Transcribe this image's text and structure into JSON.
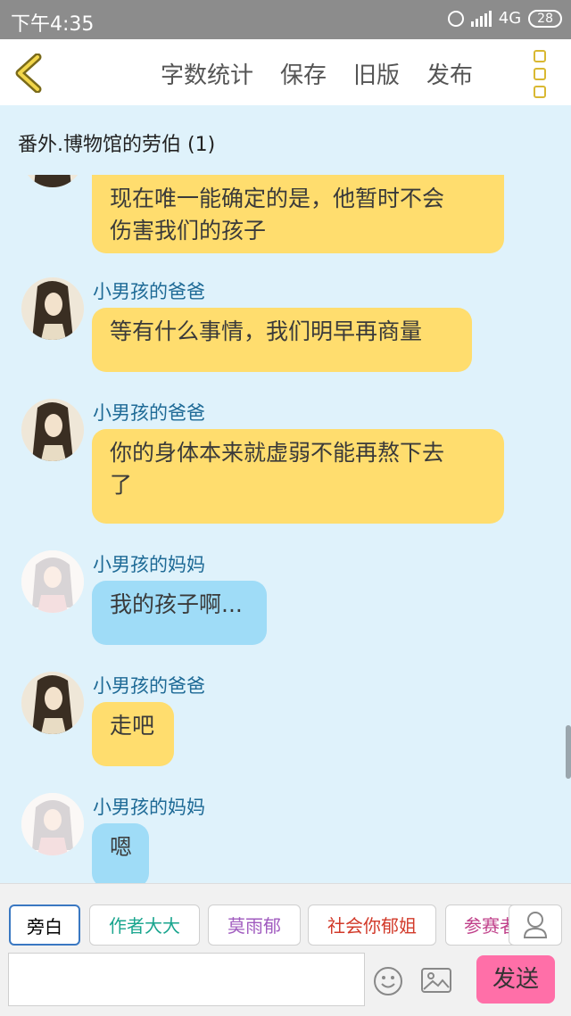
{
  "status_bar": {
    "time": "下午4:35",
    "network": "4G",
    "battery": "28"
  },
  "toolbar": {
    "items": [
      "字数统计",
      "保存",
      "旧版",
      "发布"
    ]
  },
  "chat": {
    "title": "番外.博物馆的劳伯 (1)",
    "messages": [
      {
        "sender": "",
        "role": "dad",
        "lines": [
          "现在唯一能确定的是，他暂时不会",
          "伤害我们的孩子"
        ]
      },
      {
        "sender": "小男孩的爸爸",
        "role": "dad",
        "lines": [
          "等有什么事情，我们明早再商量"
        ]
      },
      {
        "sender": "小男孩的爸爸",
        "role": "dad",
        "lines": [
          "你的身体本来就虚弱不能再熬下去",
          "了"
        ]
      },
      {
        "sender": "小男孩的妈妈",
        "role": "mom",
        "lines": [
          "我的孩子啊..."
        ]
      },
      {
        "sender": "小男孩的爸爸",
        "role": "dad",
        "lines": [
          "走吧"
        ]
      },
      {
        "sender": "小男孩的妈妈",
        "role": "mom",
        "lines": [
          "嗯"
        ]
      }
    ]
  },
  "characters": [
    {
      "label": "旁白",
      "color": "#333333"
    },
    {
      "label": "作者大大",
      "color": "#19a58e"
    },
    {
      "label": "莫雨郁",
      "color": "#a05bbf"
    },
    {
      "label": "社会你郁姐",
      "color": "#d23a2a"
    },
    {
      "label": "参赛者",
      "color": "#c0408a"
    }
  ],
  "input": {
    "value": "",
    "placeholder": ""
  },
  "send_label": "发送",
  "colors": {
    "dad_bubble": "#ffdd6e",
    "mom_bubble": "#9fdcf7",
    "chat_bg": "#dff2fb",
    "send": "#ff6fa8",
    "accent": "#d9b832"
  },
  "icons": [
    "back-chevron-icon",
    "more-icon",
    "emoji-icon",
    "image-icon",
    "person-icon"
  ]
}
